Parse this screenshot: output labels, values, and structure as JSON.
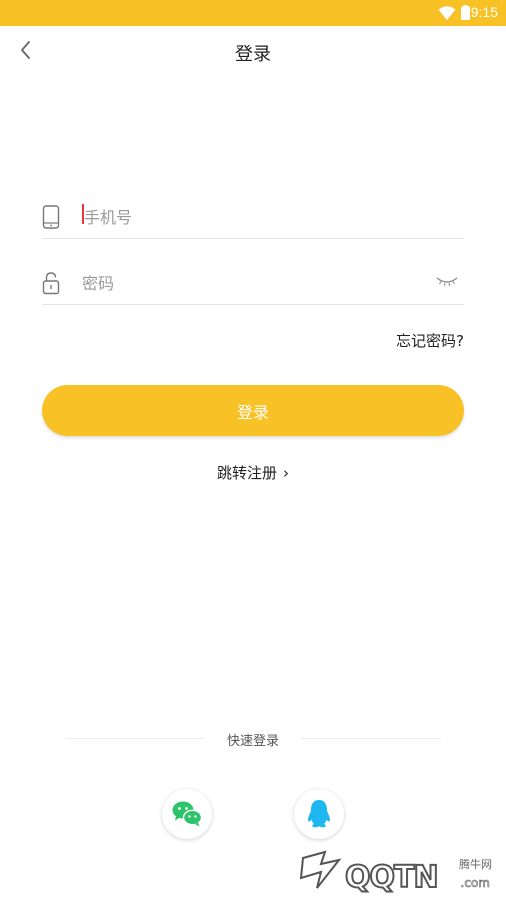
{
  "status_bar": {
    "time": "9:15",
    "wifi_icon": "wifi-icon",
    "battery_icon": "battery-icon"
  },
  "nav": {
    "back_icon": "chevron-left-icon",
    "title": "登录"
  },
  "form": {
    "phone": {
      "icon": "phone-icon",
      "placeholder": "手机号",
      "value": ""
    },
    "password": {
      "icon": "lock-icon",
      "placeholder": "密码",
      "value": "",
      "toggle_icon": "eye-closed-icon"
    },
    "forgot_label": "忘记密码?",
    "login_label": "登录",
    "register_label": "跳转注册",
    "register_arrow": "›"
  },
  "quick_login": {
    "label": "快速登录",
    "providers": [
      {
        "name": "wechat",
        "icon": "wechat-icon"
      },
      {
        "name": "qq",
        "icon": "qq-icon"
      }
    ]
  },
  "watermark": {
    "cn_text": "腾牛网",
    "brand_text": "QQTN",
    "domain_text": ".com"
  },
  "colors": {
    "accent": "#f8c226",
    "wechat": "#2dc36a",
    "qq": "#1eb7f0",
    "caret": "#e33333"
  }
}
